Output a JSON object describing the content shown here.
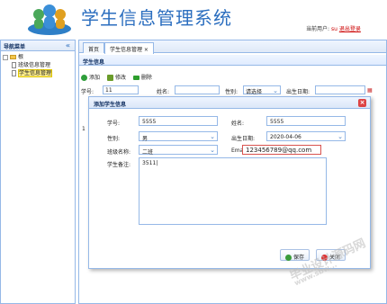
{
  "header": {
    "title": "学生信息管理系统",
    "current_user_label": "当前用户:",
    "current_user": "su",
    "logout": "退出登录"
  },
  "nav": {
    "title": "导航菜单",
    "collapse": "«",
    "root": "根",
    "items": [
      {
        "label": "班级信息管理"
      },
      {
        "label": "学生信息管理"
      }
    ]
  },
  "tabs": [
    {
      "label": "首页"
    },
    {
      "label": "学生信息管理 ×"
    }
  ],
  "panel": {
    "title": "学生信息"
  },
  "toolbar": {
    "add": "添加",
    "edit": "修改",
    "delete": "删除"
  },
  "search": {
    "no_label": "学号:",
    "no_value": "11",
    "name_label": "姓名:",
    "name_value": "",
    "gender_label": "性别:",
    "gender_value": "请选择",
    "birth_label": "出生日期:",
    "birth_value": ""
  },
  "grid": {
    "row_number": "1"
  },
  "dialog": {
    "title": "添加学生信息",
    "close": "×",
    "fields": {
      "no_label": "学号:",
      "no_value": "5555",
      "name_label": "姓名:",
      "name_value": "5555",
      "gender_label": "性别:",
      "gender_value": "男",
      "birth_label": "出生日期:",
      "birth_value": "2020-04-06",
      "class_label": "班级名称:",
      "class_value": "二班",
      "email_label": "Email:",
      "email_value": "123456789@qq.com",
      "remark_label": "学生备注:",
      "remark_value": "3511|"
    },
    "save": "保存",
    "cancel": "关闭"
  },
  "watermark": {
    "text": "毕业设计源码网",
    "url": "www.sbw..."
  },
  "colors": {
    "title": "#2b6ebf",
    "border": "#95b8e7",
    "accent": "#c00000"
  }
}
